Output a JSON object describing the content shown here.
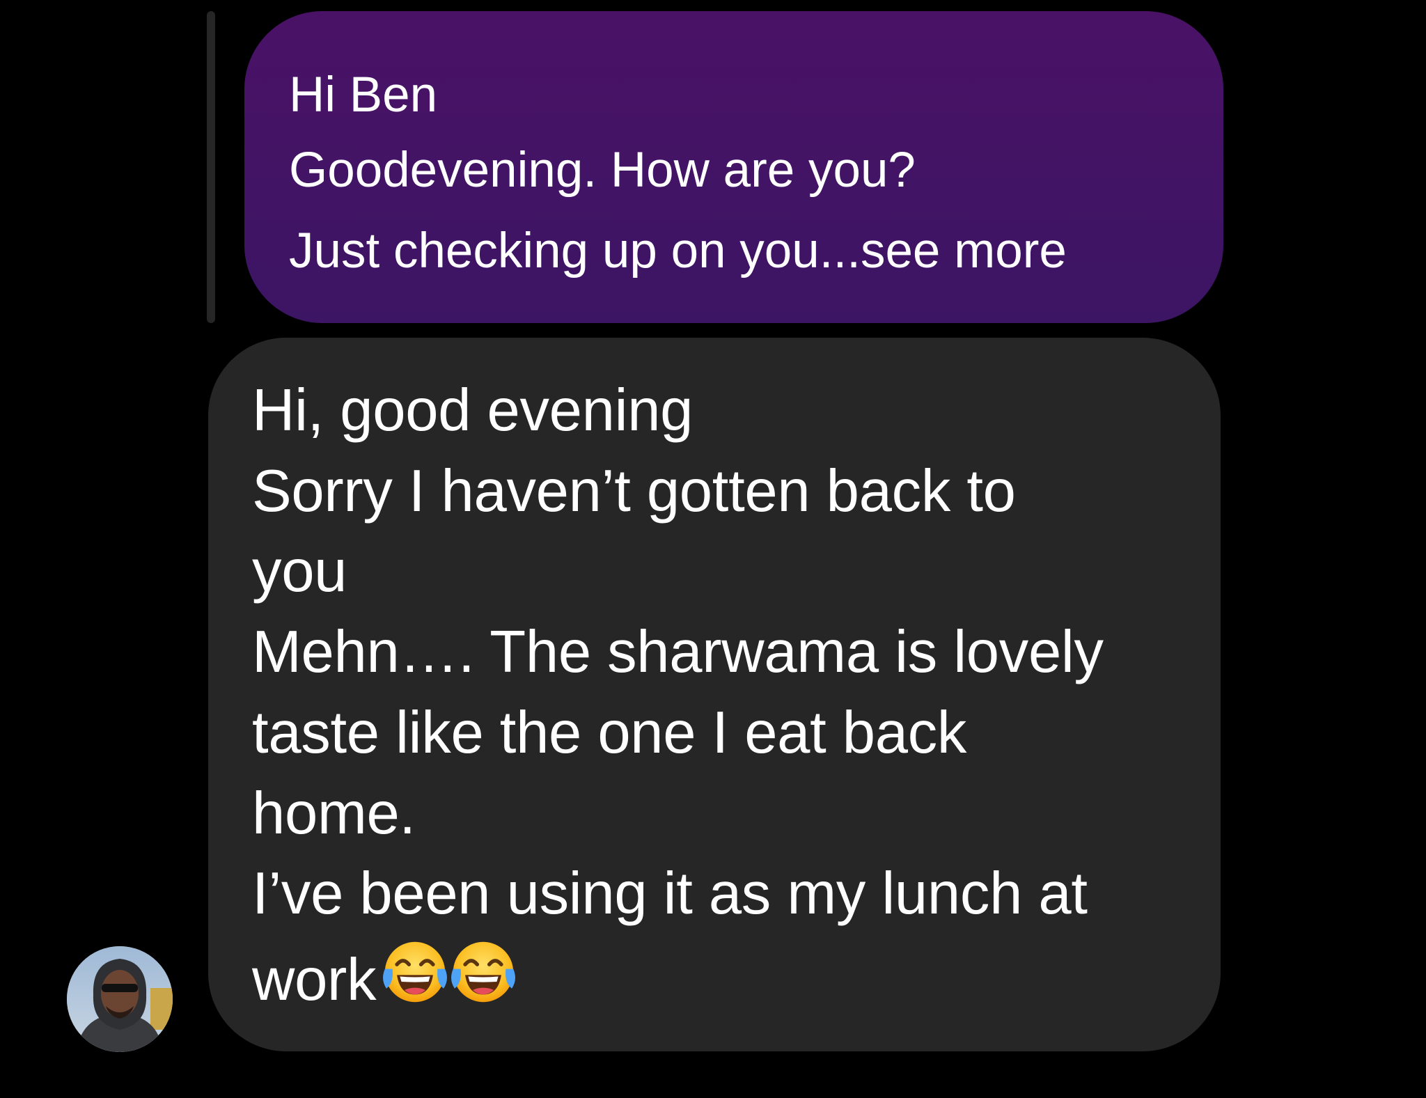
{
  "thread": {
    "quoted_message": {
      "lines": [
        "Hi Ben",
        "Goodevening. How are you?",
        "Just checking up on you...see more"
      ],
      "bubble_color": "#4a1266"
    },
    "reply_message": {
      "lines": [
        "Hi, good evening",
        "Sorry I haven’t gotten back to",
        "you",
        "Mehn…. The sharwama is lovely",
        "taste like the one I eat back",
        "home.",
        "I’ve been using it as my lunch at",
        "work"
      ],
      "trailing_emoji": [
        "face-with-tears-of-joy-icon",
        "face-with-tears-of-joy-icon"
      ],
      "bubble_color": "#262626"
    },
    "sender_avatar": {
      "icon": "avatar-photo"
    }
  },
  "colors": {
    "background": "#000000",
    "text": "#ffffff",
    "reply_bar": "#262626"
  }
}
